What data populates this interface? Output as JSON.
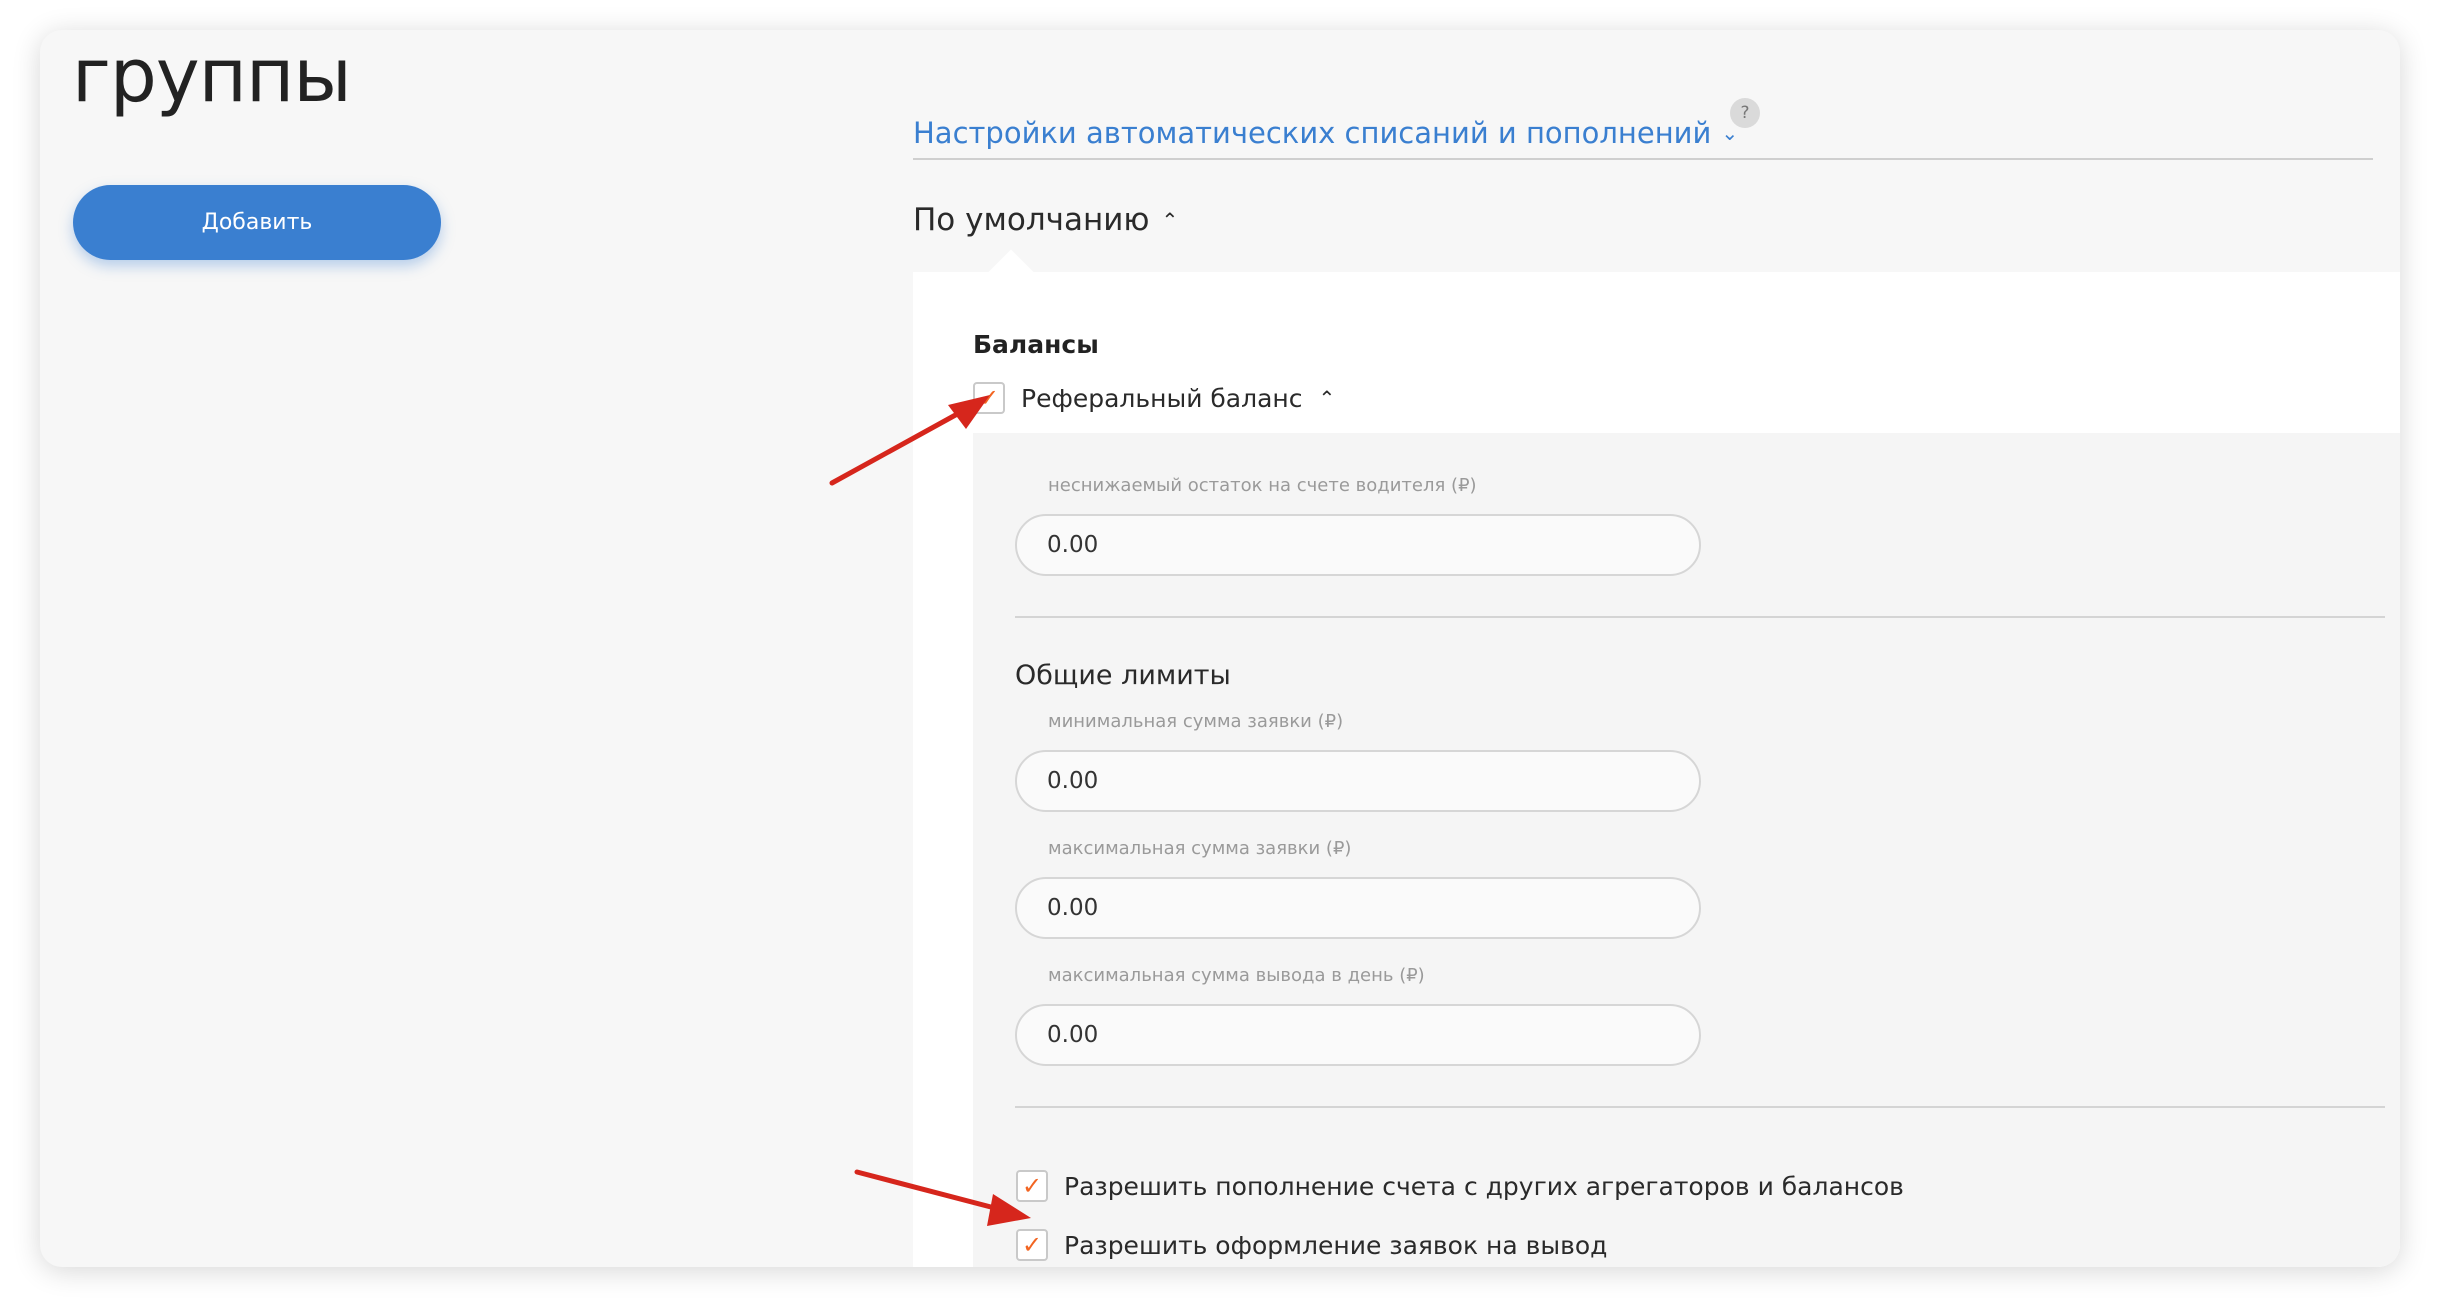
{
  "page": {
    "title": "группы",
    "add_button": "Добавить"
  },
  "settings": {
    "auto_link": "Настройки автоматических списаний и пополнений",
    "help": "?",
    "default_section": "По умолчанию"
  },
  "balances": {
    "heading": "Балансы",
    "referral": {
      "label": "Реферальный баланс",
      "checked": true,
      "min_balance": {
        "label": "неснижаемый остаток на счете водителя (₽)",
        "value": "0.00"
      }
    }
  },
  "limits": {
    "heading": "Общие лимиты",
    "fields": [
      {
        "label": "минимальная сумма заявки (₽)",
        "value": "0.00"
      },
      {
        "label": "максимальная сумма заявки (₽)",
        "value": "0.00"
      },
      {
        "label": "максимальная сумма вывода в день (₽)",
        "value": "0.00"
      }
    ]
  },
  "permissions": [
    {
      "label": "Разрешить пополнение счета с других агрегаторов и балансов",
      "checked": true
    },
    {
      "label": "Разрешить оформление заявок на вывод",
      "checked": true
    }
  ],
  "colors": {
    "accent": "#3a7fd0",
    "check": "#f26522",
    "annotation_arrow": "#d6261c"
  },
  "icons": {
    "check": "✓",
    "chevron_down": "⌄",
    "chevron_up": "⌃"
  }
}
